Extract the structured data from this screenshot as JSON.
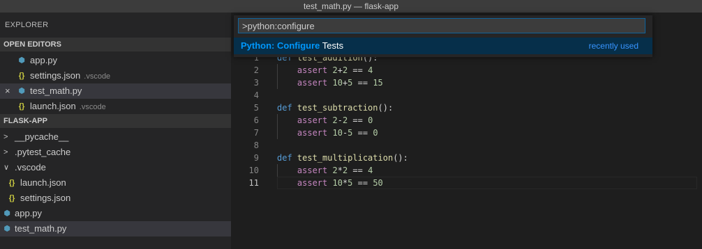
{
  "window": {
    "title": "test_math.py — flask-app"
  },
  "sidebar": {
    "title": "EXPLORER",
    "open_editors": {
      "header": "OPEN EDITORS",
      "items": [
        {
          "name": "app.py",
          "hint": "",
          "icon": "python-file-icon"
        },
        {
          "name": "settings.json",
          "hint": ".vscode",
          "icon": "json-file-icon"
        },
        {
          "name": "test_math.py",
          "hint": "",
          "icon": "python-file-icon",
          "close": "×"
        },
        {
          "name": "launch.json",
          "hint": ".vscode",
          "icon": "json-file-icon"
        }
      ]
    },
    "project": {
      "header": "FLASK-APP",
      "items": [
        {
          "name": "__pycache__",
          "chevron": ">"
        },
        {
          "name": ".pytest_cache",
          "chevron": ">"
        },
        {
          "name": ".vscode",
          "chevron": "∨"
        },
        {
          "name": "launch.json",
          "icon": "json-file-icon"
        },
        {
          "name": "settings.json",
          "icon": "json-file-icon"
        },
        {
          "name": "app.py",
          "icon": "python-file-icon"
        },
        {
          "name": "test_math.py",
          "icon": "python-file-icon"
        }
      ]
    }
  },
  "icons": {
    "json": "{}",
    "python": "⬢"
  },
  "palette": {
    "input_value": ">python:configure",
    "result": {
      "match": "Python: Configure",
      "rest": " Tests",
      "tag": "recently used"
    }
  },
  "editor": {
    "lines": [
      {
        "n": "1",
        "parts": [
          [
            "kw",
            "def "
          ],
          [
            "fn",
            "test_addition"
          ],
          [
            "plain",
            "():"
          ]
        ]
      },
      {
        "n": "2",
        "parts": [
          [
            "plain",
            "    "
          ],
          [
            "kw2",
            "assert "
          ],
          [
            "num",
            "2"
          ],
          [
            "plain",
            "+"
          ],
          [
            "num",
            "2"
          ],
          [
            "plain",
            " == "
          ],
          [
            "num",
            "4"
          ]
        ]
      },
      {
        "n": "3",
        "parts": [
          [
            "plain",
            "    "
          ],
          [
            "kw2",
            "assert "
          ],
          [
            "num",
            "10"
          ],
          [
            "plain",
            "+"
          ],
          [
            "num",
            "5"
          ],
          [
            "plain",
            " == "
          ],
          [
            "num",
            "15"
          ]
        ]
      },
      {
        "n": "4",
        "parts": []
      },
      {
        "n": "5",
        "parts": [
          [
            "kw",
            "def "
          ],
          [
            "fn",
            "test_subtraction"
          ],
          [
            "plain",
            "():"
          ]
        ]
      },
      {
        "n": "6",
        "parts": [
          [
            "plain",
            "    "
          ],
          [
            "kw2",
            "assert "
          ],
          [
            "num",
            "2"
          ],
          [
            "plain",
            "-"
          ],
          [
            "num",
            "2"
          ],
          [
            "plain",
            " == "
          ],
          [
            "num",
            "0"
          ]
        ]
      },
      {
        "n": "7",
        "parts": [
          [
            "plain",
            "    "
          ],
          [
            "kw2",
            "assert "
          ],
          [
            "num",
            "10"
          ],
          [
            "plain",
            "-"
          ],
          [
            "num",
            "5"
          ],
          [
            "plain",
            " == "
          ],
          [
            "num",
            "0"
          ]
        ]
      },
      {
        "n": "8",
        "parts": []
      },
      {
        "n": "9",
        "parts": [
          [
            "kw",
            "def "
          ],
          [
            "fn",
            "test_multiplication"
          ],
          [
            "plain",
            "():"
          ]
        ]
      },
      {
        "n": "10",
        "parts": [
          [
            "plain",
            "    "
          ],
          [
            "kw2",
            "assert "
          ],
          [
            "num",
            "2"
          ],
          [
            "plain",
            "*"
          ],
          [
            "num",
            "2"
          ],
          [
            "plain",
            " == "
          ],
          [
            "num",
            "4"
          ]
        ]
      },
      {
        "n": "11",
        "parts": [
          [
            "plain",
            "    "
          ],
          [
            "kw2",
            "assert "
          ],
          [
            "num",
            "10"
          ],
          [
            "plain",
            "*"
          ],
          [
            "num",
            "5"
          ],
          [
            "plain",
            " == "
          ],
          [
            "num",
            "50"
          ]
        ]
      }
    ]
  },
  "colors": {
    "accent": "#0e639c",
    "match": "#0097fb",
    "keyword": "#569cd6",
    "control": "#c586c0",
    "function": "#dcdcaa",
    "number": "#b5cea8"
  }
}
